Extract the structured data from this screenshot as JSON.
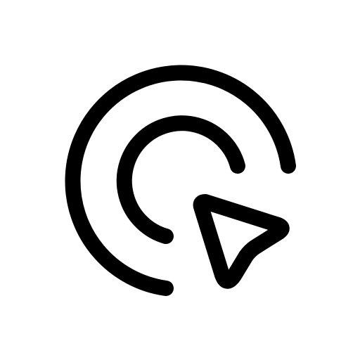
{
  "icon": {
    "name": "click-target-cursor-icon",
    "stroke_color": "#000000",
    "background_color": "#ffffff"
  }
}
